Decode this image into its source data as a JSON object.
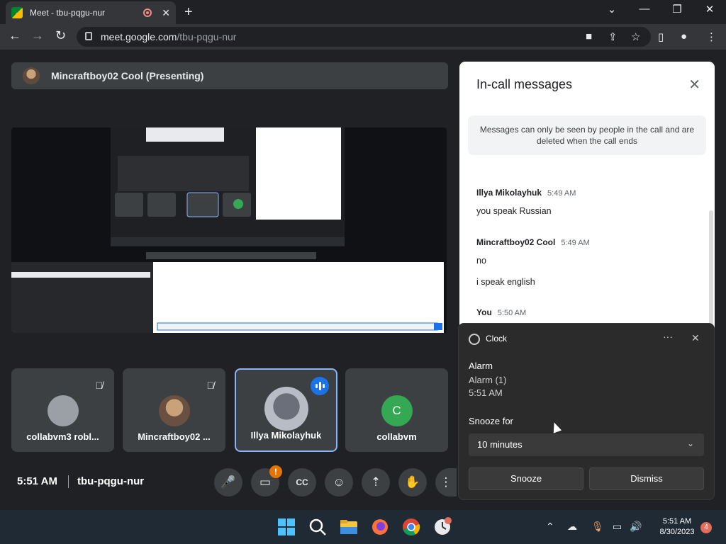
{
  "browser": {
    "tab_title": "Meet - tbu-pqgu-nur",
    "tab_close": "✕",
    "new_tab": "+",
    "url_host": "meet.google.com",
    "url_path": "/tbu-pqgu-nur",
    "window_controls": [
      "⌄",
      "—",
      "❐",
      "✕"
    ]
  },
  "meet": {
    "presenter_label": "Mincraftboy02 Cool (Presenting)",
    "tiles": [
      {
        "name": "collabvm3 robl...",
        "muted": true
      },
      {
        "name": "Mincraftboy02 ...",
        "muted": true
      },
      {
        "name": "Illya Mikolayhuk",
        "speaking": true
      },
      {
        "name": "collabvm",
        "initial": "C",
        "color": "#34a853"
      }
    ],
    "time": "5:51 AM",
    "meeting_code": "tbu-pqgu-nur",
    "alert_badge": "!"
  },
  "chat": {
    "title": "In-call messages",
    "close": "✕",
    "notice": "Messages can only be seen by people in the call and are deleted when the call ends",
    "messages": [
      {
        "sender": "Illya Mikolayhuk",
        "time": "5:49 AM",
        "lines": [
          "you speak Russian"
        ]
      },
      {
        "sender": "Mincraftboy02 Cool",
        "time": "5:49 AM",
        "lines": [
          "no",
          "i speak english"
        ]
      },
      {
        "sender": "You",
        "time": "5:50 AM",
        "lines": []
      }
    ]
  },
  "toast": {
    "app": "Clock",
    "more": "···",
    "close": "✕",
    "heading": "Alarm",
    "alarm_name": "Alarm (1)",
    "alarm_time": "5:51 AM",
    "snooze_label": "Snooze for",
    "snooze_value": "10 minutes",
    "snooze_button": "Snooze",
    "dismiss_button": "Dismiss"
  },
  "taskbar": {
    "time": "5:51 AM",
    "date": "8/30/2023",
    "notifications": "4"
  },
  "colors": {
    "meet_bg": "#202124",
    "accent": "#1a73e8",
    "presenter_bar": "#3c4043"
  }
}
